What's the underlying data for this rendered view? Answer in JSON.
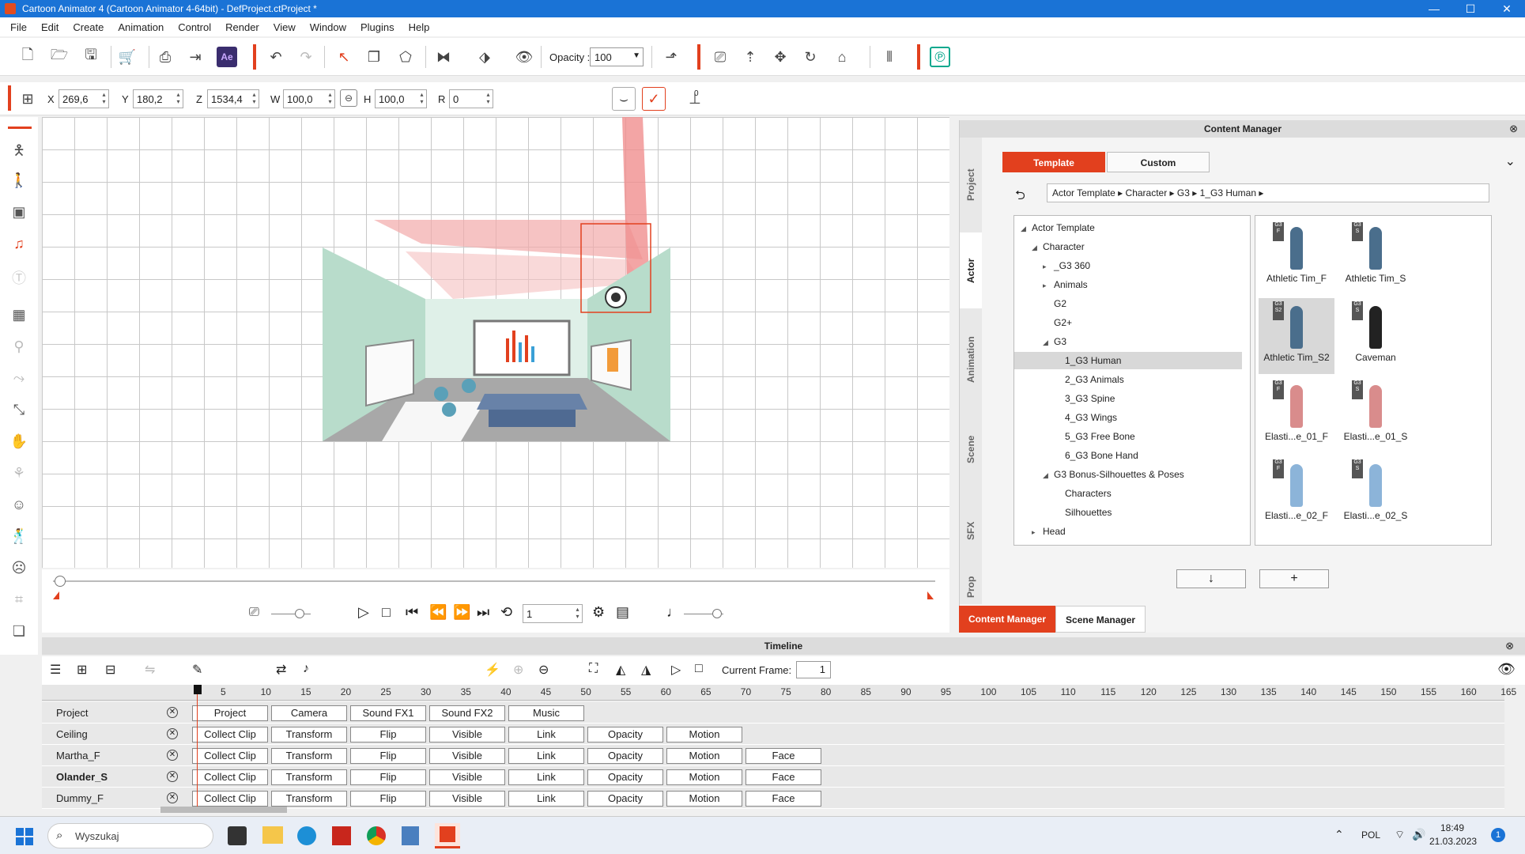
{
  "window": {
    "title": "Cartoon Animator 4  (Cartoon Animator 4-64bit) - DefProject.ctProject *",
    "minimize": "—",
    "maximize": "☐",
    "close": "✕"
  },
  "menu": [
    "File",
    "Edit",
    "Create",
    "Animation",
    "Control",
    "Render",
    "View",
    "Window",
    "Plugins",
    "Help"
  ],
  "toolbar": {
    "opacity_label": "Opacity :",
    "opacity_value": "100",
    "ae_label": "Ae"
  },
  "transform": {
    "x_label": "X",
    "x_value": "269,6",
    "y_label": "Y",
    "y_value": "180,2",
    "z_label": "Z",
    "z_value": "1534,4",
    "w_label": "W",
    "w_value": "100,0",
    "h_label": "H",
    "h_value": "100,0",
    "r_label": "R",
    "r_value": "0",
    "extra_value": "0"
  },
  "playback": {
    "frame_value": "1"
  },
  "content_manager": {
    "title": "Content Manager",
    "tab_template": "Template",
    "tab_custom": "Custom",
    "vtabs": [
      "Project",
      "Actor",
      "Animation",
      "Scene",
      "SFX",
      "Prop"
    ],
    "path": [
      "Actor Template",
      "Character",
      "G3",
      "1_G3 Human"
    ],
    "tree": [
      {
        "label": "Actor Template",
        "level": 0,
        "arrow": "◢"
      },
      {
        "label": "Character",
        "level": 1,
        "arrow": "◢"
      },
      {
        "label": "_G3 360",
        "level": 2,
        "arrow": "▸"
      },
      {
        "label": "Animals",
        "level": 2,
        "arrow": "▸"
      },
      {
        "label": "G2",
        "level": 2,
        "arrow": ""
      },
      {
        "label": "G2+",
        "level": 2,
        "arrow": ""
      },
      {
        "label": "G3",
        "level": 2,
        "arrow": "◢"
      },
      {
        "label": "1_G3 Human",
        "level": 3,
        "arrow": "",
        "selected": true
      },
      {
        "label": "2_G3 Animals",
        "level": 3,
        "arrow": ""
      },
      {
        "label": "3_G3 Spine",
        "level": 3,
        "arrow": ""
      },
      {
        "label": "4_G3 Wings",
        "level": 3,
        "arrow": ""
      },
      {
        "label": "5_G3 Free Bone",
        "level": 3,
        "arrow": ""
      },
      {
        "label": "6_G3 Bone Hand",
        "level": 3,
        "arrow": ""
      },
      {
        "label": "G3 Bonus-Silhouettes & Poses",
        "level": 2,
        "arrow": "◢"
      },
      {
        "label": "Characters",
        "level": 3,
        "arrow": ""
      },
      {
        "label": "Silhouettes",
        "level": 3,
        "arrow": ""
      },
      {
        "label": "Head",
        "level": 1,
        "arrow": "▸"
      }
    ],
    "thumbs": [
      {
        "label": "Athletic Tim_F",
        "badge": "G3 F",
        "color": "#4a6e8c"
      },
      {
        "label": "Athletic Tim_S",
        "badge": "G3 S",
        "color": "#4a6e8c"
      },
      {
        "label": "Athletic Tim_S2",
        "badge": "G3 S2",
        "color": "#4a6e8c",
        "selected": true
      },
      {
        "label": "Caveman",
        "badge": "G3 S",
        "color": "#222222"
      },
      {
        "label": "Elasti...e_01_F",
        "badge": "G3 F",
        "color": "#d98c8c"
      },
      {
        "label": "Elasti...e_01_S",
        "badge": "G3 S",
        "color": "#d98c8c"
      },
      {
        "label": "Elasti...e_02_F",
        "badge": "G3 F",
        "color": "#8cb4d9"
      },
      {
        "label": "Elasti...e_02_S",
        "badge": "G3 S",
        "color": "#8cb4d9"
      }
    ],
    "down_btn": "↓",
    "add_btn": "+"
  },
  "panel_tabs": {
    "content_manager": "Content Manager",
    "scene_manager": "Scene Manager"
  },
  "timeline": {
    "title": "Timeline",
    "current_frame_label": "Current Frame:",
    "current_frame_value": "1",
    "ticks": [
      "5",
      "10",
      "15",
      "20",
      "25",
      "30",
      "35",
      "40",
      "45",
      "50",
      "55",
      "60",
      "65",
      "70",
      "75",
      "80",
      "85",
      "90",
      "95",
      "100",
      "105",
      "110",
      "115",
      "120",
      "125",
      "130",
      "135",
      "140",
      "145",
      "150",
      "155",
      "160",
      "165"
    ],
    "tracks": [
      {
        "name": "Project",
        "bold": false,
        "clips": [
          "Project",
          "Camera",
          "Sound FX1",
          "Sound FX2",
          "Music"
        ]
      },
      {
        "name": "Ceiling",
        "bold": false,
        "clips": [
          "Collect Clip",
          "Transform",
          "Flip",
          "Visible",
          "Link",
          "Opacity",
          "Motion"
        ]
      },
      {
        "name": "Martha_F",
        "bold": false,
        "clips": [
          "Collect Clip",
          "Transform",
          "Flip",
          "Visible",
          "Link",
          "Opacity",
          "Motion",
          "Face"
        ]
      },
      {
        "name": "Olander_S",
        "bold": true,
        "clips": [
          "Collect Clip",
          "Transform",
          "Flip",
          "Visible",
          "Link",
          "Opacity",
          "Motion",
          "Face"
        ]
      },
      {
        "name": "Dummy_F",
        "bold": false,
        "clips": [
          "Collect Clip",
          "Transform",
          "Flip",
          "Visible",
          "Link",
          "Opacity",
          "Motion",
          "Face"
        ]
      }
    ]
  },
  "taskbar": {
    "search_placeholder": "Wyszukaj",
    "lang": "POL",
    "time": "18:49",
    "date": "21.03.2023",
    "notif_count": "1"
  },
  "colors": {
    "accent_red": "#e2401e",
    "titlebar_blue": "#1a73d6",
    "wall_green": "#b8dccb",
    "floor_grey": "#a8a8a8"
  }
}
